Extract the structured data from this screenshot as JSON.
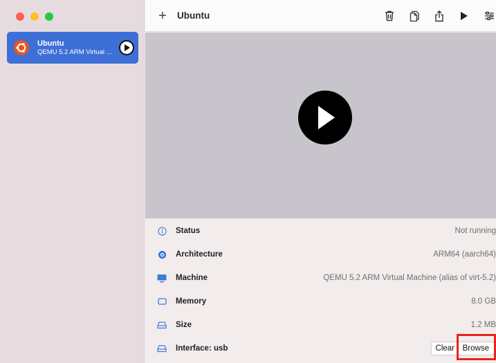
{
  "sidebar": {
    "vm": {
      "name": "Ubuntu",
      "subtitle": "QEMU 5.2 ARM Virtual M..."
    }
  },
  "toolbar": {
    "add_symbol": "+",
    "title": "Ubuntu",
    "icons": [
      "trash-icon",
      "copy-icon",
      "share-icon",
      "play-icon",
      "settings-sliders-icon"
    ]
  },
  "info": {
    "rows": [
      {
        "label": "Status",
        "value": "Not running",
        "icon": "info-icon"
      },
      {
        "label": "Architecture",
        "value": "ARM64 (aarch64)",
        "icon": "cpu-icon"
      },
      {
        "label": "Machine",
        "value": "QEMU 5.2 ARM Virtual Machine (alias of virt-5.2)",
        "icon": "monitor-icon"
      },
      {
        "label": "Memory",
        "value": "8.0 GB",
        "icon": "memory-icon"
      },
      {
        "label": "Size",
        "value": "1.2 MB",
        "icon": "drive-icon"
      },
      {
        "label": "Interface: usb",
        "value": "",
        "icon": "drive-icon"
      }
    ],
    "clear_label": "Clear",
    "browse_label": "Browse"
  },
  "colors": {
    "selection": "#3d6fd6",
    "highlight": "#e8231b",
    "ubuntu": "#e95420",
    "icon_blue": "#3d7bd9"
  }
}
